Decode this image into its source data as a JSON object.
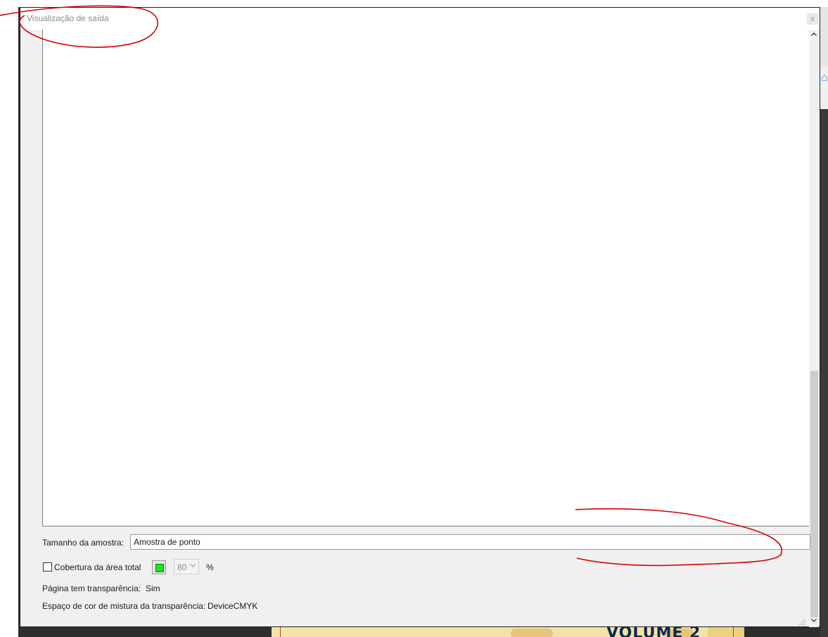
{
  "dialog": {
    "title": "Visualização de saída",
    "close_label": "x"
  },
  "sample": {
    "label": "Tamanho da amostra:",
    "value": "Amostra de ponto"
  },
  "coverage": {
    "label": "Cobertura da área total",
    "checked": false,
    "swatch_color": "#20e020",
    "percent_value": "80",
    "percent_symbol": "%"
  },
  "info": {
    "transparency_label": "Página tem transparência:",
    "transparency_value": "Sim",
    "blend_label": "Espaço de cor de mistura da transparência:",
    "blend_value": "DeviceCMYK"
  },
  "background": {
    "page_text": "VOLUME 2"
  },
  "icons": {
    "scroll_up": "chevron-up-icon",
    "scroll_down": "chevron-down-icon",
    "dropdown": "chevron-down-icon",
    "resize": "resize-grip-icon"
  },
  "annotation_color": "#d40000"
}
